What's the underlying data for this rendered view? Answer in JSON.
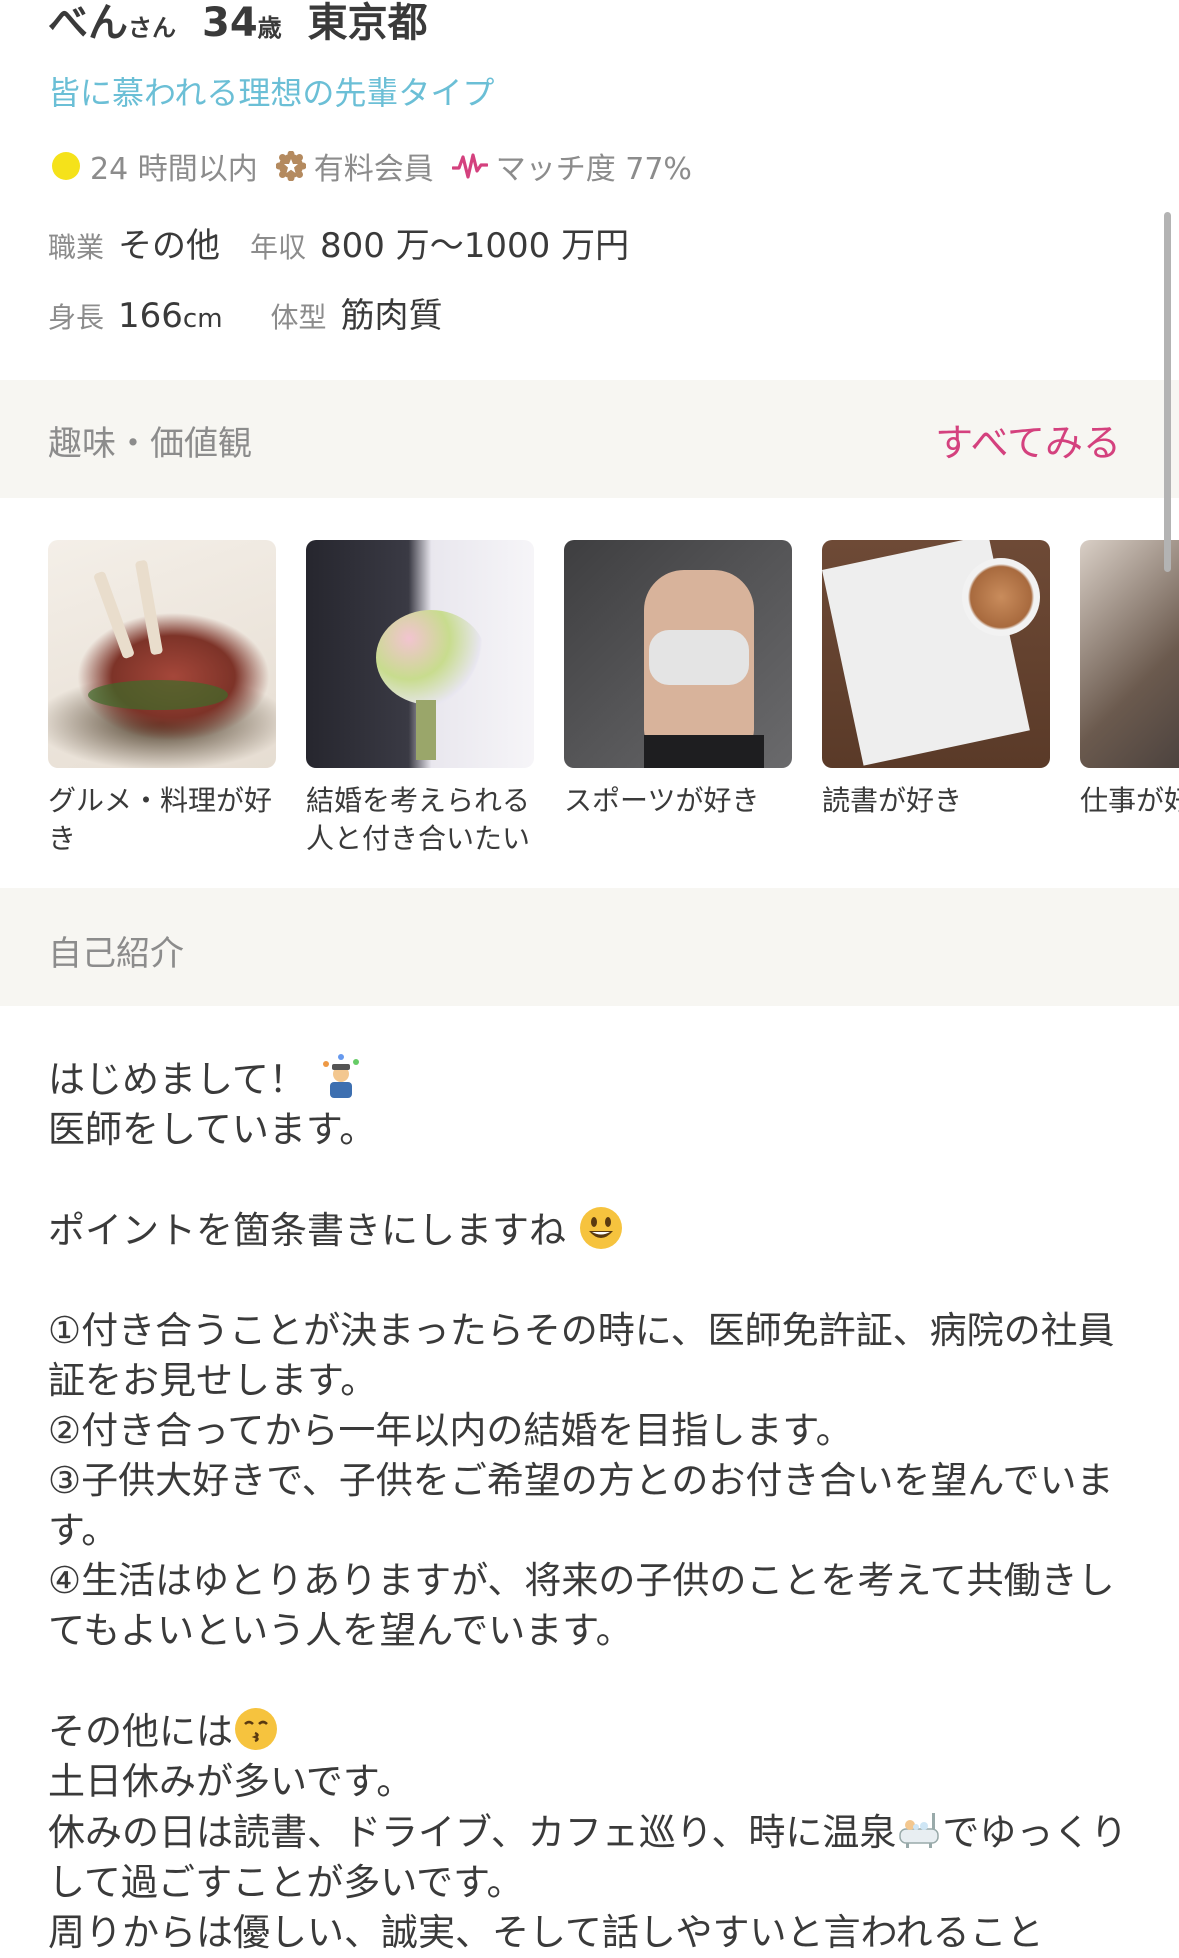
{
  "profile": {
    "name": "べん",
    "name_suffix": "さん",
    "age": "34",
    "age_suffix": "歳",
    "location": "東京都",
    "catchphrase": "皆に慕われる理想の先輩タイプ",
    "login_status": "24 時間以内",
    "membership": "有料会員",
    "match_rate": "マッチ度 77%",
    "job_label": "職業",
    "job_value": "その他",
    "income_label": "年収",
    "income_value": "800 万～1000 万円",
    "height_label": "身長",
    "height_value": "166",
    "height_unit": "cm",
    "body_label": "体型",
    "body_value": "筋肉質"
  },
  "hobbies": {
    "title": "趣味・価値観",
    "see_all": "すべてみる",
    "items": [
      {
        "label": "グルメ・料理が好き"
      },
      {
        "label": "結婚を考えられる人と付き合いたい"
      },
      {
        "label": "スポーツが好き"
      },
      {
        "label": "読書が好き"
      },
      {
        "label": "仕事が好"
      }
    ]
  },
  "intro": {
    "title": "自己紹介",
    "lines": [
      "はじめまして！",
      "医師をしています。",
      "",
      "ポイントを箇条書きにしますね",
      "",
      "①付き合うことが決まったらその時に、医師免許証、病院の社員証をお見せします。",
      "②付き合ってから一年以内の結婚を目指します。",
      "③子供大好きで、子供をご希望の方とのお付き合いを望んでいます。",
      "④生活はゆとりありますが、将来の子供のことを考えて共働きしてもよいという人を望んでいます。",
      "",
      "その他には",
      "土日休みが多いです。",
      "休みの日は読書、ドライブ、カフェ巡り、時に温泉",
      "でゆっくりして過ごすことが多いです。",
      "周りからは優しい、誠実、そして話しやすいと言われること"
    ]
  },
  "colors": {
    "accent_pink": "#d4417e",
    "catch_blue": "#6bbfd6",
    "online_yellow": "#f5e21a",
    "section_bg": "#f7f6f2"
  },
  "icons": [
    "online-dot-icon",
    "member-gear-icon",
    "match-pulse-icon",
    "juggler-emoji-icon",
    "smile-emoji-icon",
    "kiss-emoji-icon",
    "bathtub-emoji-icon"
  ]
}
